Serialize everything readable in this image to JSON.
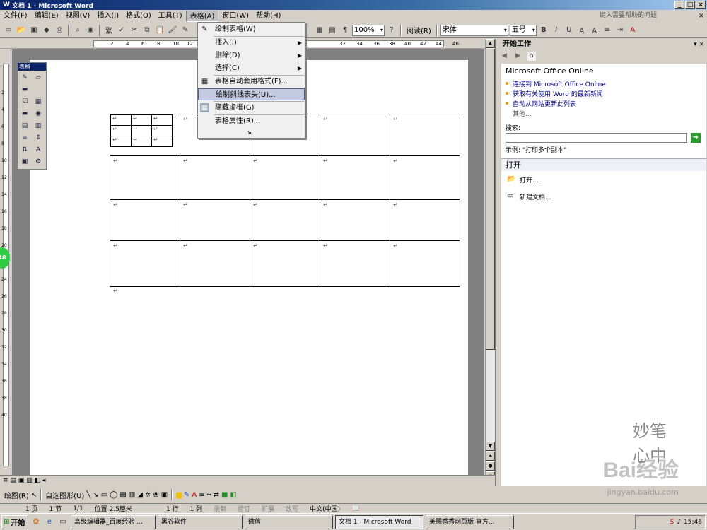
{
  "window": {
    "title": "文档 1 - Microsoft Word",
    "help_placeholder": "键入需要帮助的问题"
  },
  "menubar": {
    "items": [
      "文件(F)",
      "编辑(E)",
      "视图(V)",
      "插入(I)",
      "格式(O)",
      "工具(T)",
      "表格(A)",
      "窗口(W)",
      "帮助(H)"
    ]
  },
  "toolbar": {
    "zoom": "100%",
    "read_label": "阅读(R)",
    "font": "宋体",
    "size": "五号",
    "bold": "B",
    "italic": "I",
    "underline": "U",
    "font_color_label": "A"
  },
  "table_menu": {
    "items": [
      {
        "label": "绘制表格(W)",
        "icon": "pencil-icon",
        "has_sub": false,
        "highlight": false
      },
      {
        "label": "插入(I)",
        "icon": "",
        "has_sub": true,
        "highlight": false
      },
      {
        "label": "删除(D)",
        "icon": "",
        "has_sub": true,
        "highlight": false
      },
      {
        "label": "选择(C)",
        "icon": "",
        "has_sub": true,
        "highlight": false
      },
      {
        "label": "表格自动套用格式(F)...",
        "icon": "table-autoformat-icon",
        "has_sub": false,
        "highlight": false
      },
      {
        "label": "绘制斜线表头(U)...",
        "icon": "",
        "has_sub": false,
        "highlight": true
      },
      {
        "label": "隐藏虚框(G)",
        "icon": "grid-icon",
        "has_sub": false,
        "highlight": false
      },
      {
        "label": "表格属性(R)...",
        "icon": "",
        "has_sub": false,
        "highlight": false
      }
    ],
    "more": "»"
  },
  "float_toolbar": {
    "title": "表格"
  },
  "ruler": {
    "numbers": [
      "2",
      "4",
      "6",
      "8",
      "10",
      "12",
      "32",
      "34",
      "36",
      "38",
      "40",
      "42",
      "44",
      "46"
    ]
  },
  "vruler": {
    "numbers": [
      "2",
      "4",
      "6",
      "8",
      "10",
      "12",
      "14",
      "16",
      "18",
      "20",
      "22",
      "24",
      "26",
      "28",
      "30",
      "32",
      "34",
      "36",
      "38",
      "40"
    ]
  },
  "page_badge": "48",
  "document": {
    "cell_mark": "↵",
    "paragraph_mark": "↵"
  },
  "taskpane": {
    "title": "开始工作",
    "section_online": "Microsoft Office Online",
    "links": [
      "连接到 Microsoft Office Online",
      "获取有关使用 Word 的最新新闻",
      "自动从网站更新此列表"
    ],
    "more": "其他...",
    "search_label": "搜索:",
    "example": "示例: \"打印多个副本\"",
    "open_heading": "打开",
    "open_link": "打开...",
    "new_doc": "新建文档..."
  },
  "drawbar": {
    "draw_label": "绘图(R)",
    "autoshapes_label": "自选图形(U)"
  },
  "status": {
    "page": "1 页",
    "section": "1 节",
    "page_of": "1/1",
    "position": "位置 2.5厘米",
    "line": "1 行",
    "col": "1 列",
    "rec": "录制",
    "trk": "修订",
    "ext": "扩展",
    "ovr": "改写",
    "lang": "中文(中国)"
  },
  "taskbar": {
    "start": "开始",
    "tasks": [
      "高级编辑器_百度经验 ...",
      "黑谷软件",
      "微信",
      "文档 1 - Microsoft Word",
      "美图秀秀网页版 官方..."
    ],
    "clock": "15:46"
  },
  "watermark": {
    "text": "Bai经验",
    "url": "jingyan.baidu.com"
  }
}
